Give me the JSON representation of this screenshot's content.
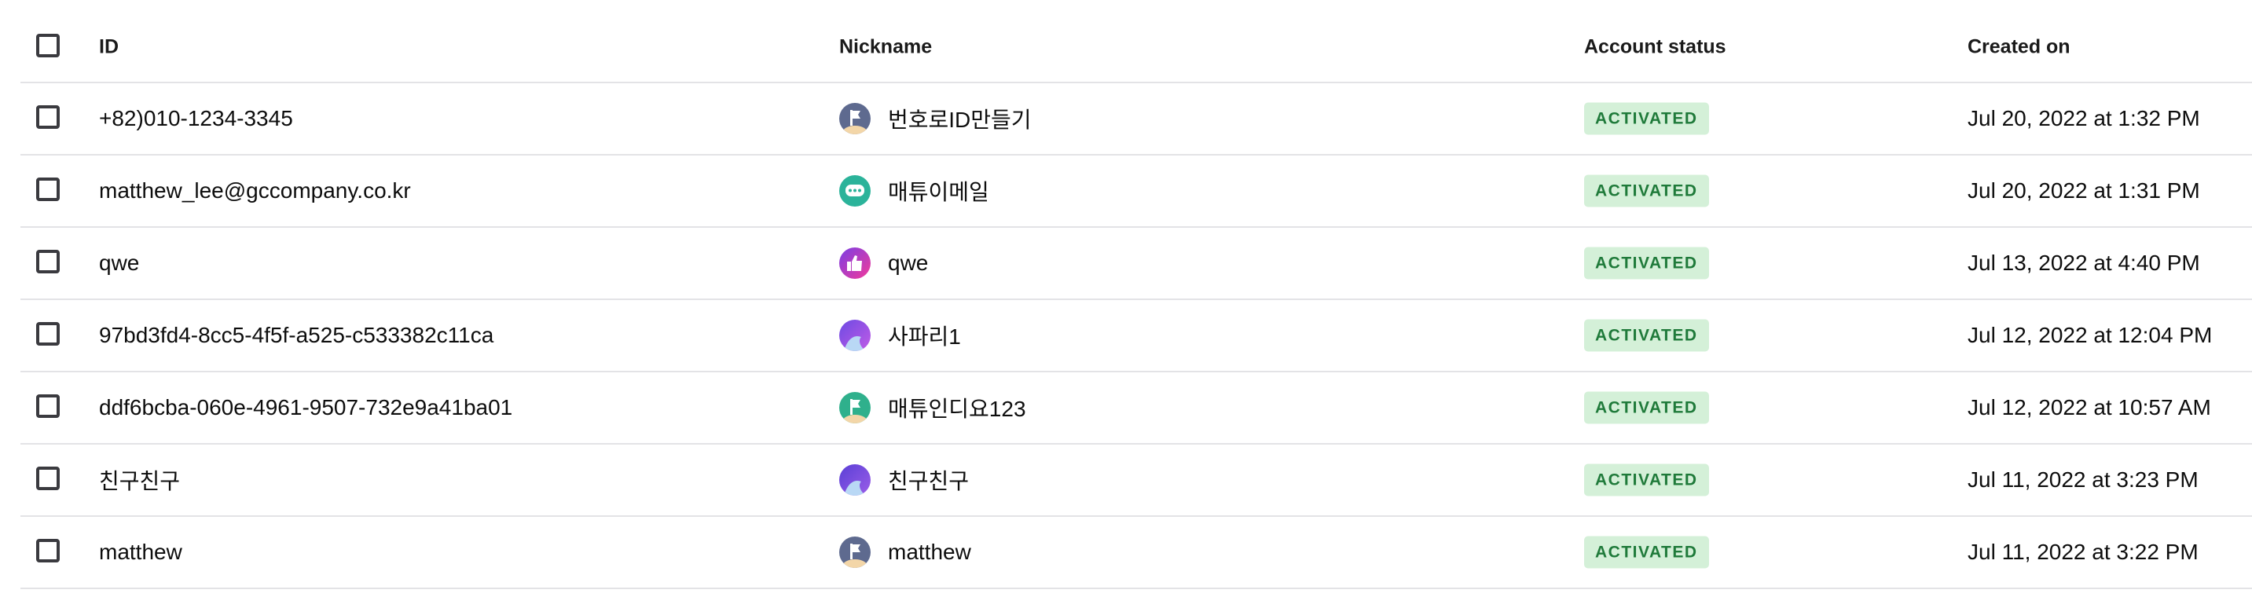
{
  "columns": {
    "id": "ID",
    "nickname": "Nickname",
    "account_status": "Account status",
    "created_on": "Created on"
  },
  "rows": [
    {
      "id": "+82)010-1234-3345",
      "nickname": "번호로ID만들기",
      "avatar_icon": "flag-avatar-icon",
      "avatar_color": "#5e6a8f",
      "status": "ACTIVATED",
      "created_on": "Jul 20, 2022 at 1:32 PM"
    },
    {
      "id": "matthew_lee@gccompany.co.kr",
      "nickname": "매튜이메일",
      "avatar_icon": "chat-bubble-avatar-icon",
      "avatar_color": "#2bb39a",
      "status": "ACTIVATED",
      "created_on": "Jul 20, 2022 at 1:31 PM"
    },
    {
      "id": "qwe",
      "nickname": "qwe",
      "avatar_icon": "thumbs-up-avatar-icon",
      "avatar_color": "#a24be0",
      "status": "ACTIVATED",
      "created_on": "Jul 13, 2022 at 4:40 PM"
    },
    {
      "id": "97bd3fd4-8cc5-4f5f-a525-c533382c11ca",
      "nickname": "사파리1",
      "avatar_icon": "wave-avatar-icon",
      "avatar_color": "#8a5ae0",
      "status": "ACTIVATED",
      "created_on": "Jul 12, 2022 at 12:04 PM"
    },
    {
      "id": "ddf6bcba-060e-4961-9507-732e9a41ba01",
      "nickname": "매튜인디요123",
      "avatar_icon": "flag-avatar-icon",
      "avatar_color": "#2fb08c",
      "status": "ACTIVATED",
      "created_on": "Jul 12, 2022 at 10:57 AM"
    },
    {
      "id": "친구친구",
      "nickname": "친구친구",
      "avatar_icon": "wave-avatar-icon",
      "avatar_color": "#6b4fd8",
      "status": "ACTIVATED",
      "created_on": "Jul 11, 2022 at 3:23 PM"
    },
    {
      "id": "matthew",
      "nickname": "matthew",
      "avatar_icon": "flag-avatar-icon",
      "avatar_color": "#5e6a8f",
      "status": "ACTIVATED",
      "created_on": "Jul 11, 2022 at 3:22 PM"
    }
  ],
  "colors": {
    "badge_bg": "#d4f0d8",
    "badge_text": "#1f7a3a",
    "row_divider": "#e3e3e6",
    "checkbox_border": "#3a3a3f"
  }
}
